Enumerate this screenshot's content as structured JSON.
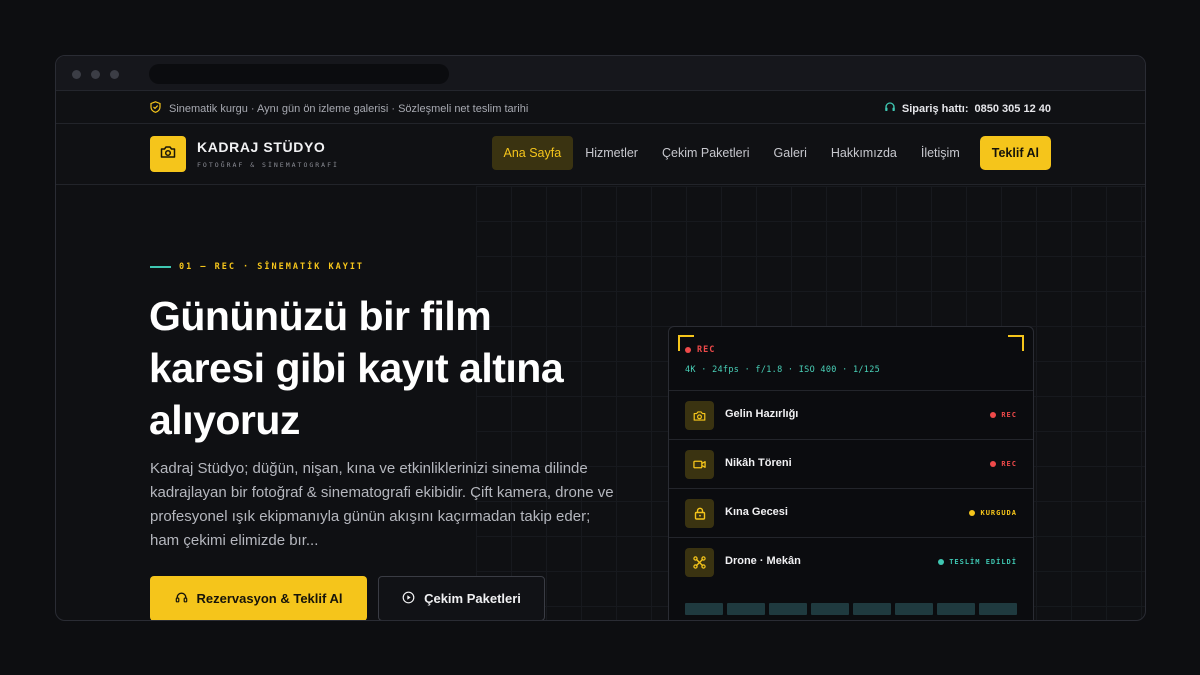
{
  "topbar": {
    "tagline": "Sinematik kurgu · Aynı gün ön izleme galerisi · Sözleşmeli net teslim tarihi",
    "phone_label": "Sipariş hattı:",
    "phone_number": "0850 305 12 40"
  },
  "brand": {
    "name": "KADRAJ STÜDYO",
    "tagline": "FOTOĞRAF & SİNEMATOGRAFİ"
  },
  "nav": {
    "items": [
      {
        "label": "Ana Sayfa",
        "active": true
      },
      {
        "label": "Hizmetler",
        "active": false
      },
      {
        "label": "Çekim Paketleri",
        "active": false
      },
      {
        "label": "Galeri",
        "active": false
      },
      {
        "label": "Hakkımızda",
        "active": false
      },
      {
        "label": "İletişim",
        "active": false
      }
    ],
    "cta": "Teklif Al"
  },
  "hero": {
    "eyebrow": "01 — REC · SİNEMATİK KAYIT",
    "headline": "Gününüzü bir film karesi gibi kayıt altına alıyoruz",
    "lead": "Kadraj Stüdyo; düğün, nişan, kına ve etkinliklerinizi sinema dilinde kadrajlayan bir fotoğraf & sinematografi ekibidir. Çift kamera, drone ve profesyonel ışık ekipmanıyla günün akışını kaçırmadan takip eder; ham çekimi elimizde bır...",
    "primary_button": "Rezervasyon & Teklif Al",
    "secondary_button": "Çekim Paketleri"
  },
  "monitor": {
    "rec_label": "REC",
    "specs": "4K · 24fps · f/1.8 · ISO 400 · 1/125",
    "rows": [
      {
        "icon": "camera-icon",
        "title": "Gelin Hazırlığı",
        "status": "REC",
        "status_color": "#ef4a4a"
      },
      {
        "icon": "video-icon",
        "title": "Nikâh Töreni",
        "status": "REC",
        "status_color": "#ef4a4a"
      },
      {
        "icon": "lock-icon",
        "title": "Kına Gecesi",
        "status": "KURGUDA",
        "status_color": "#f5c51b"
      },
      {
        "icon": "drone-icon",
        "title": "Drone · Mekân",
        "status": "TESLİM EDİLDİ",
        "status_color": "#3fc7b2"
      }
    ]
  },
  "colors": {
    "accent": "#f5c51b",
    "teal": "#3fc7b2",
    "rec_red": "#ef4a4a",
    "background": "#0f1013"
  }
}
